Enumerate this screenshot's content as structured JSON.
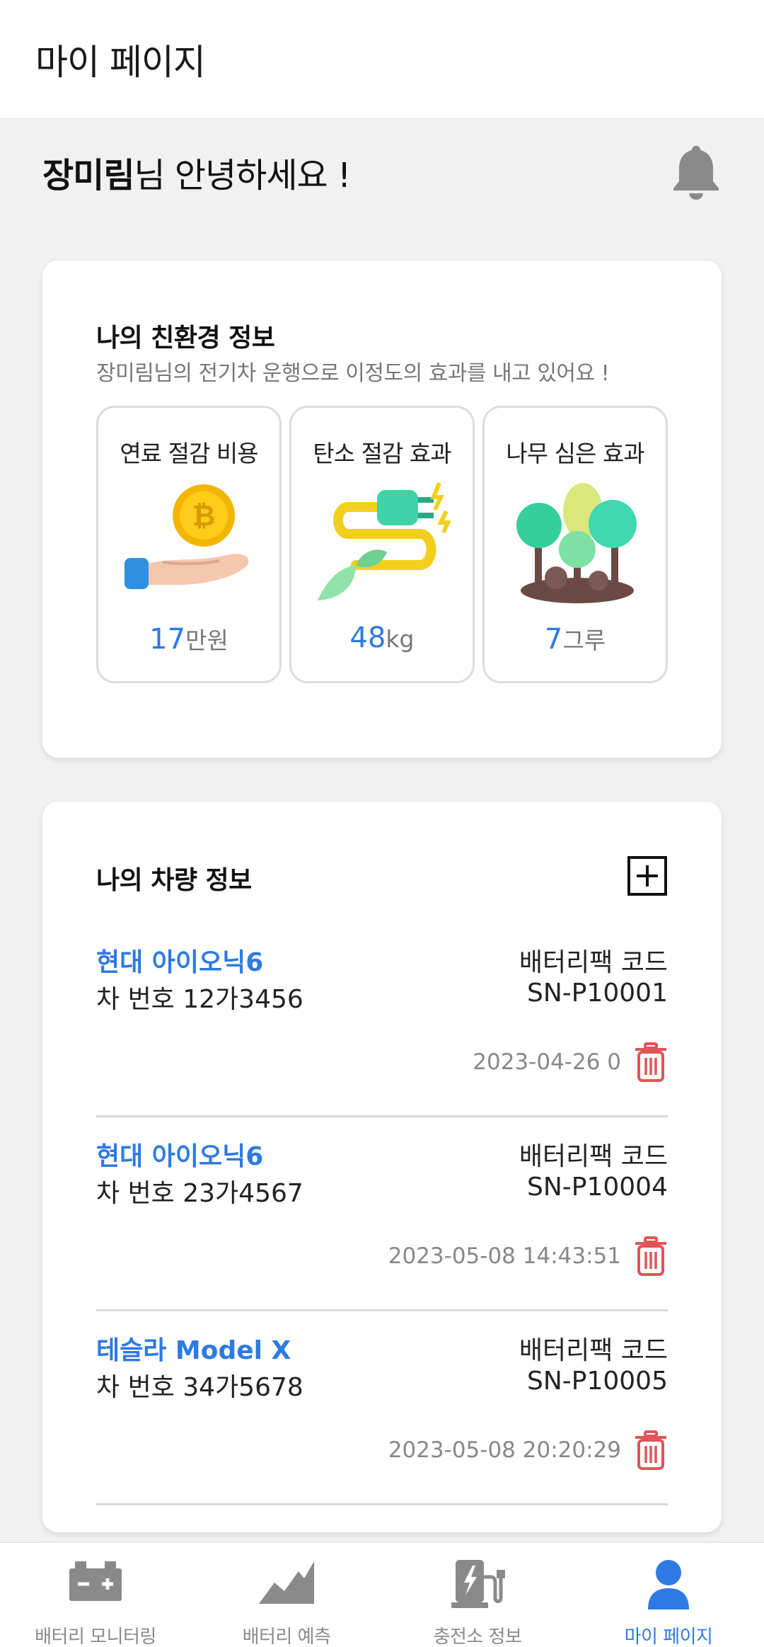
{
  "app_bar": {
    "title": "마이 페이지"
  },
  "greeting": {
    "name": "장미림",
    "message": "님 안녕하세요 !"
  },
  "eco": {
    "title": "나의 친환경 정보",
    "subtitle": "장미림님의 전기차 운행으로 이정도의 효과를 내고 있어요 !",
    "tiles": [
      {
        "label": "연료 절감 비용",
        "value": "17",
        "unit": "만원",
        "icon": "coin-hand-icon"
      },
      {
        "label": "탄소 절감 효과",
        "value": "48",
        "unit": "kg",
        "icon": "plug-leaf-icon"
      },
      {
        "label": "나무 심은 효과",
        "value": "7",
        "unit": "그루",
        "icon": "trees-icon"
      }
    ]
  },
  "vehicles": {
    "title": "나의 차량 정보",
    "items": [
      {
        "model": "현대 아이오닉6",
        "plate": "차 번호 12가3456",
        "code_label": "배터리팩 코드",
        "code": "SN-P10001",
        "date": "2023-04-26 0"
      },
      {
        "model": "현대 아이오닉6",
        "plate": "차 번호 23가4567",
        "code_label": "배터리팩 코드",
        "code": "SN-P10004",
        "date": "2023-05-08 14:43:51"
      },
      {
        "model": "테슬라 Model X",
        "plate": "차 번호 34가5678",
        "code_label": "배터리팩 코드",
        "code": "SN-P10005",
        "date": "2023-05-08 20:20:29"
      }
    ]
  },
  "nav": {
    "items": [
      {
        "label": "배터리 모니터링",
        "icon": "battery-icon"
      },
      {
        "label": "배터리 예측",
        "icon": "chart-area-icon"
      },
      {
        "label": "충전소 정보",
        "icon": "charging-station-icon"
      },
      {
        "label": "마이 페이지",
        "icon": "user-icon",
        "active": true
      }
    ]
  },
  "colors": {
    "accent": "#2d7ae3",
    "delete": "#e05555",
    "background": "#f1f1f1"
  }
}
